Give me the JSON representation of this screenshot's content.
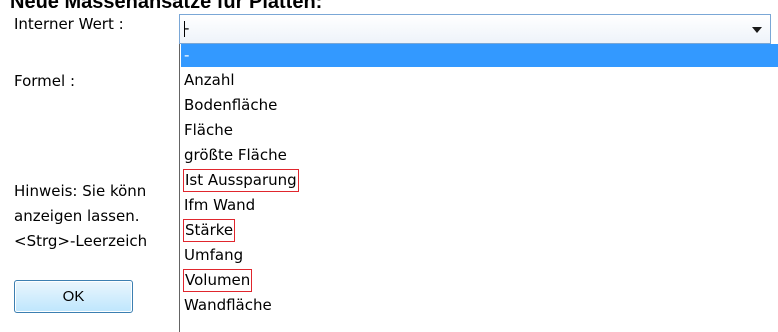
{
  "dialog": {
    "title": "Neue Massenansätze für Platten:",
    "internal_value_label": "Interner Wert :",
    "formula_label": "Formel :",
    "hint_lines": [
      "Hinweis: Sie könn",
      "anzeigen lassen.",
      "<Strg>-Leerzeich"
    ],
    "ok_label": "OK"
  },
  "combo": {
    "value": "-"
  },
  "dropdown": {
    "options": [
      {
        "label": "-",
        "selected": true,
        "highlighted": false
      },
      {
        "label": "Anzahl",
        "selected": false,
        "highlighted": false
      },
      {
        "label": "Bodenfläche",
        "selected": false,
        "highlighted": false
      },
      {
        "label": "Fläche",
        "selected": false,
        "highlighted": false
      },
      {
        "label": "größte Fläche",
        "selected": false,
        "highlighted": false
      },
      {
        "label": "Ist Aussparung",
        "selected": false,
        "highlighted": true
      },
      {
        "label": "Ifm Wand",
        "selected": false,
        "highlighted": false
      },
      {
        "label": "Stärke",
        "selected": false,
        "highlighted": true
      },
      {
        "label": "Umfang",
        "selected": false,
        "highlighted": false
      },
      {
        "label": "Volumen",
        "selected": false,
        "highlighted": true
      },
      {
        "label": "Wandfläche",
        "selected": false,
        "highlighted": false
      }
    ]
  },
  "icons": {
    "combo_arrow": "chevron-down-icon"
  },
  "colors": {
    "selection": "#3399ff",
    "highlight_box": "#e0262d",
    "combo_border": "#7aa7d6"
  }
}
